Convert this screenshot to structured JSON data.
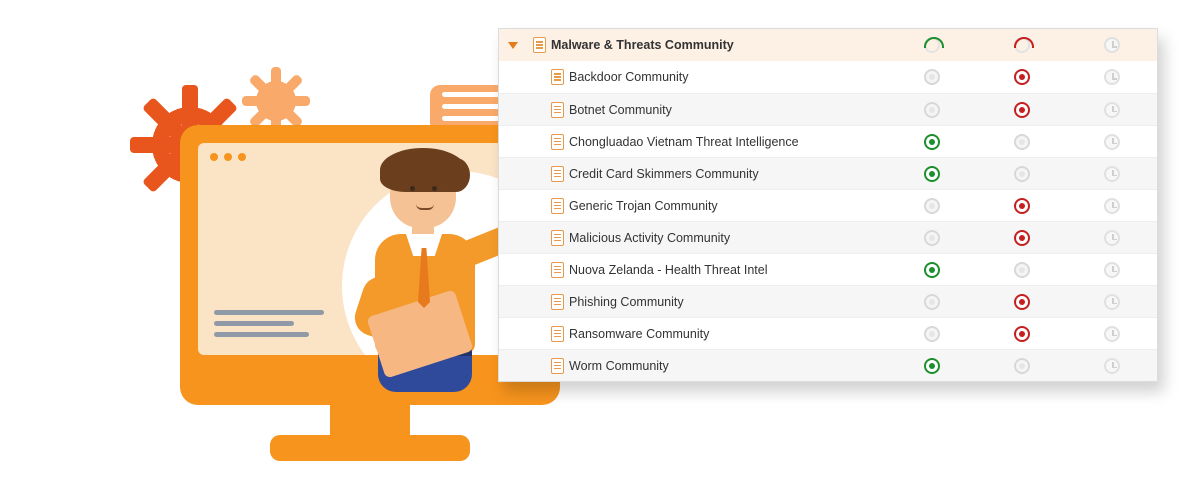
{
  "panel": {
    "header": {
      "label": "Malware & Threats Community",
      "status": [
        "ring-green",
        "ring-red",
        "clock"
      ]
    },
    "rows": [
      {
        "label": "Backdoor Community",
        "status": [
          "off",
          "red",
          "clock"
        ]
      },
      {
        "label": "Botnet Community",
        "status": [
          "off",
          "red",
          "clock"
        ]
      },
      {
        "label": "Chongluadao Vietnam Threat Intelligence",
        "status": [
          "green",
          "off",
          "clock"
        ]
      },
      {
        "label": "Credit Card Skimmers Community",
        "status": [
          "green",
          "off",
          "clock"
        ]
      },
      {
        "label": "Generic Trojan Community",
        "status": [
          "off",
          "red",
          "clock"
        ]
      },
      {
        "label": "Malicious Activity Community",
        "status": [
          "off",
          "red",
          "clock"
        ]
      },
      {
        "label": "Nuova Zelanda - Health Threat Intel",
        "status": [
          "green",
          "off",
          "clock"
        ]
      },
      {
        "label": "Phishing Community",
        "status": [
          "off",
          "red",
          "clock"
        ]
      },
      {
        "label": "Ransomware Community",
        "status": [
          "off",
          "red",
          "clock"
        ]
      },
      {
        "label": "Worm Community",
        "status": [
          "green",
          "off",
          "clock"
        ]
      }
    ]
  },
  "colors": {
    "orange": "#f7941d",
    "orange_dark": "#e8551d",
    "green": "#1e8f2e",
    "red": "#c52020"
  }
}
